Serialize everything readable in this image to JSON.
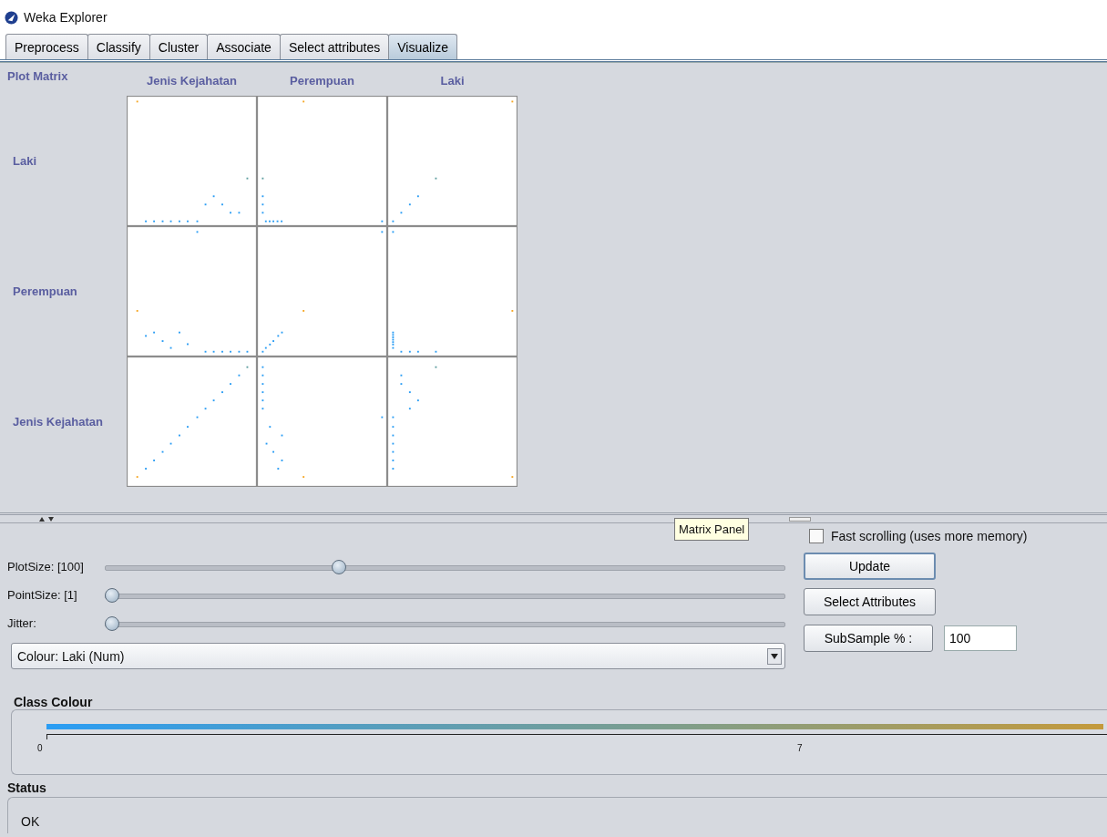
{
  "window": {
    "title": "Weka Explorer"
  },
  "tabs": [
    {
      "label": "Preprocess",
      "selected": false
    },
    {
      "label": "Classify",
      "selected": false
    },
    {
      "label": "Cluster",
      "selected": false
    },
    {
      "label": "Associate",
      "selected": false
    },
    {
      "label": "Select attributes",
      "selected": false
    },
    {
      "label": "Visualize",
      "selected": true
    }
  ],
  "plot_matrix": {
    "title": "Plot Matrix",
    "column_headers": [
      "Jenis Kejahatan",
      "Perempuan",
      "Laki"
    ],
    "row_headers": [
      "Laki",
      "Perempuan",
      "Jenis Kejahatan"
    ]
  },
  "tooltip": "Matrix Panel",
  "sliders": [
    {
      "label": "PlotSize: [100]",
      "level": 0.34
    },
    {
      "label": "PointSize: [1]",
      "level": 0.0
    },
    {
      "label": "Jitter:",
      "level": 0.0
    }
  ],
  "colour_select": {
    "value": "Colour:  Laki  (Num)"
  },
  "fast_scrolling": {
    "label": "Fast scrolling (uses more memory)",
    "checked": false
  },
  "update_button": "Update",
  "select_attributes_button": "Select Attributes",
  "subsample": {
    "button": "SubSample % :",
    "value": "100"
  },
  "class_colour": {
    "title": "Class Colour",
    "ticks": [
      "0",
      "7"
    ]
  },
  "status": {
    "title": "Status",
    "text": "OK"
  }
}
